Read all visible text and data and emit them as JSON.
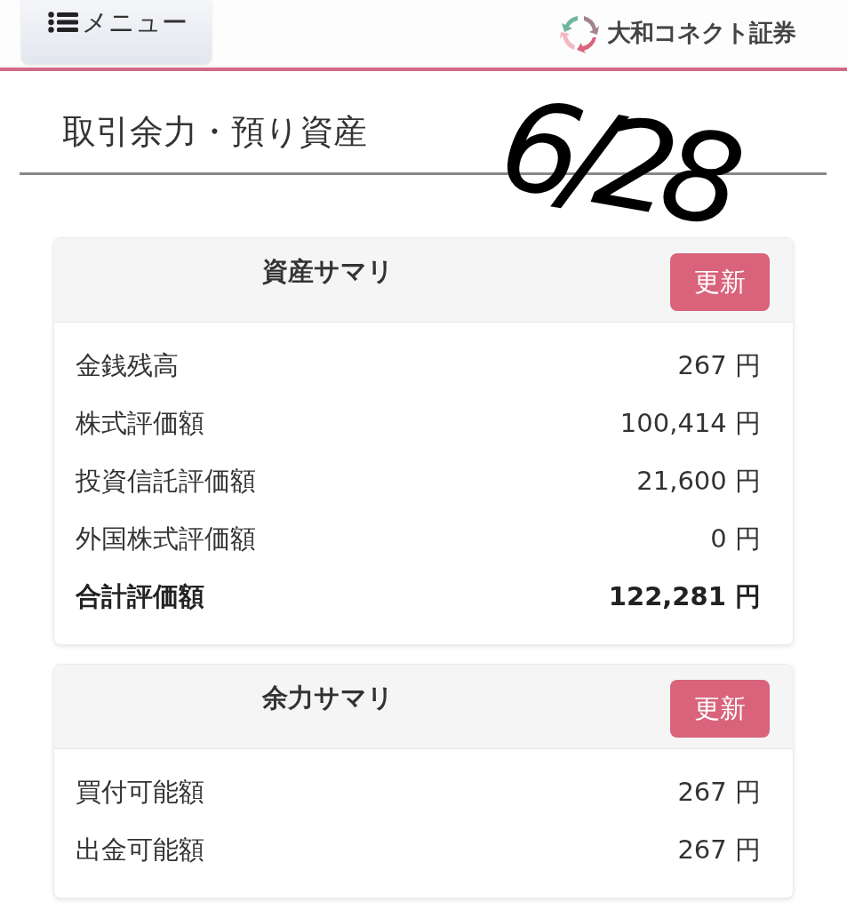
{
  "header": {
    "menu_button": {
      "label": "メニュー"
    },
    "brand": {
      "name": "大和コネクト証券"
    }
  },
  "page_title": "取引余力・預り資産",
  "handwritten_note": "6/28",
  "cards": [
    {
      "title": "資産サマリ",
      "button": "更新",
      "rows": [
        {
          "label": "金銭残高",
          "value": "267 円",
          "kind": "normal"
        },
        {
          "label": "株式評価額",
          "value": "100,414 円",
          "kind": "normal"
        },
        {
          "label": "投資信託評価額",
          "value": "21,600 円",
          "kind": "normal"
        },
        {
          "label": "外国株式評価額",
          "value": "0 円",
          "kind": "normal"
        },
        {
          "label": "合計評価額",
          "value": "122,281 円",
          "kind": "total"
        }
      ]
    },
    {
      "title": "余力サマリ",
      "button": "更新",
      "rows": [
        {
          "label": "買付可能額",
          "value": "267 円",
          "kind": "normal"
        },
        {
          "label": "出金可能額",
          "value": "267 円",
          "kind": "normal"
        }
      ]
    }
  ]
}
